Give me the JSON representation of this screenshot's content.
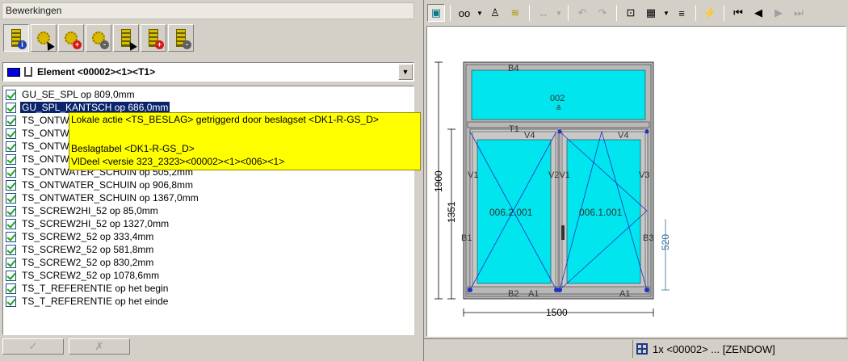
{
  "left_panel": {
    "title": "Bewerkingen",
    "toolbar": [
      {
        "icon": "beslag-info-icon",
        "badge": "i"
      },
      {
        "icon": "gear-select-icon"
      },
      {
        "icon": "gear-add-icon",
        "badge": "+"
      },
      {
        "icon": "gear-remove-icon",
        "badge": "-"
      },
      {
        "icon": "beslag-select-icon"
      },
      {
        "icon": "beslag-add-icon",
        "badge": "+"
      },
      {
        "icon": "beslag-remove-icon",
        "badge": "-"
      }
    ],
    "element_selector": {
      "value": "Element <00002><1><T1>",
      "color": "#0000e0"
    },
    "operations": [
      {
        "label": "GU_SE_SPL op 809,0mm",
        "checked": true
      },
      {
        "label": "GU_SPL_KANTSCH op 686,0mm",
        "checked": true,
        "selected": true
      },
      {
        "label": "TS_ONTWATER_SCHUIN op 65,0mm",
        "checked": true
      },
      {
        "label": "TS_ONTWATER_SCHUIN op 166,5mm",
        "checked": true
      },
      {
        "label": "TS_ONTWATER_SCHUIN op 268,0mm",
        "checked": true
      },
      {
        "label": "TS_ONTWATER_SCHUIN op 369,5mm",
        "checked": true
      },
      {
        "label": "TS_ONTWATER_SCHUIN op 505,2mm",
        "checked": true
      },
      {
        "label": "TS_ONTWATER_SCHUIN op 906,8mm",
        "checked": true
      },
      {
        "label": "TS_ONTWATER_SCHUIN op 1367,0mm",
        "checked": true
      },
      {
        "label": "TS_SCREW2HI_52 op 85,0mm",
        "checked": true
      },
      {
        "label": "TS_SCREW2HI_52 op 1327,0mm",
        "checked": true
      },
      {
        "label": "TS_SCREW2_52 op 333,4mm",
        "checked": true
      },
      {
        "label": "TS_SCREW2_52 op 581,8mm",
        "checked": true
      },
      {
        "label": "TS_SCREW2_52 op 830,2mm",
        "checked": true
      },
      {
        "label": "TS_SCREW2_52 op 1078,6mm",
        "checked": true
      },
      {
        "label": "TS_T_REFERENTIE op het begin",
        "checked": true
      },
      {
        "label": "TS_T_REFERENTIE op het einde",
        "checked": true
      }
    ],
    "tooltip": {
      "line1": "Lokale actie <TS_BESLAG> getriggerd door beslagset <DK1-R-GS_D>",
      "line2": "Beslagtabel <DK1-R-GS_D>",
      "line3": "VlDeel <versie 323_2323><00002><1><006><1>"
    },
    "footer_buttons": [
      {
        "icon": "confirm-icon",
        "glyph": "✓"
      },
      {
        "icon": "cancel-icon",
        "glyph": "✗"
      }
    ]
  },
  "right_panel": {
    "toolbar": [
      {
        "icon": "frame-view-icon",
        "glyph": "▣",
        "pressed": true
      },
      {
        "icon": "glasses-icon",
        "glyph": "oo"
      },
      {
        "icon": "dropdown-icon",
        "glyph": "▼"
      },
      {
        "icon": "person-icon",
        "glyph": "♙"
      },
      {
        "icon": "layers-icon",
        "glyph": "≋"
      },
      {
        "icon": "dimension-icon",
        "glyph": "↔",
        "dim": true
      },
      {
        "icon": "dropdown-icon",
        "glyph": "▼",
        "dim": true
      },
      {
        "icon": "undo-icon",
        "glyph": "↶",
        "dim": true
      },
      {
        "icon": "redo-icon",
        "glyph": "↷",
        "dim": true
      },
      {
        "icon": "zoom-select-icon",
        "glyph": "⊡"
      },
      {
        "icon": "select-box-icon",
        "glyph": "▦"
      },
      {
        "icon": "dropdown-icon",
        "glyph": "▼"
      },
      {
        "icon": "align-icon",
        "glyph": "≡"
      },
      {
        "icon": "settings-lightning-icon",
        "glyph": "⚡"
      },
      {
        "icon": "first-icon",
        "glyph": "⏮"
      },
      {
        "icon": "prev-icon",
        "glyph": "◀"
      },
      {
        "icon": "next-icon",
        "glyph": "▶",
        "dim": true
      },
      {
        "icon": "last-icon",
        "glyph": "⏭",
        "dim": true
      }
    ],
    "drawing": {
      "glass_color": "#00e5ee",
      "labels": {
        "B4": "B4",
        "top_pane": "002",
        "T1": "T1",
        "V4_left": "V4",
        "V4_right": "V4",
        "V1": "V1",
        "V2V1": "V2V1",
        "V3": "V3",
        "B1": "B1",
        "B3": "B3",
        "B2": "B2",
        "A1_left": "A1",
        "A1_right": "A1",
        "left_pane": "006.2.001",
        "right_pane": "006.1.001"
      },
      "dims": {
        "height_total": "1900",
        "height_lower": "1351",
        "width": "1500",
        "handle_height": "520"
      }
    },
    "status": "1x <00002> ... [ZENDOW]"
  }
}
